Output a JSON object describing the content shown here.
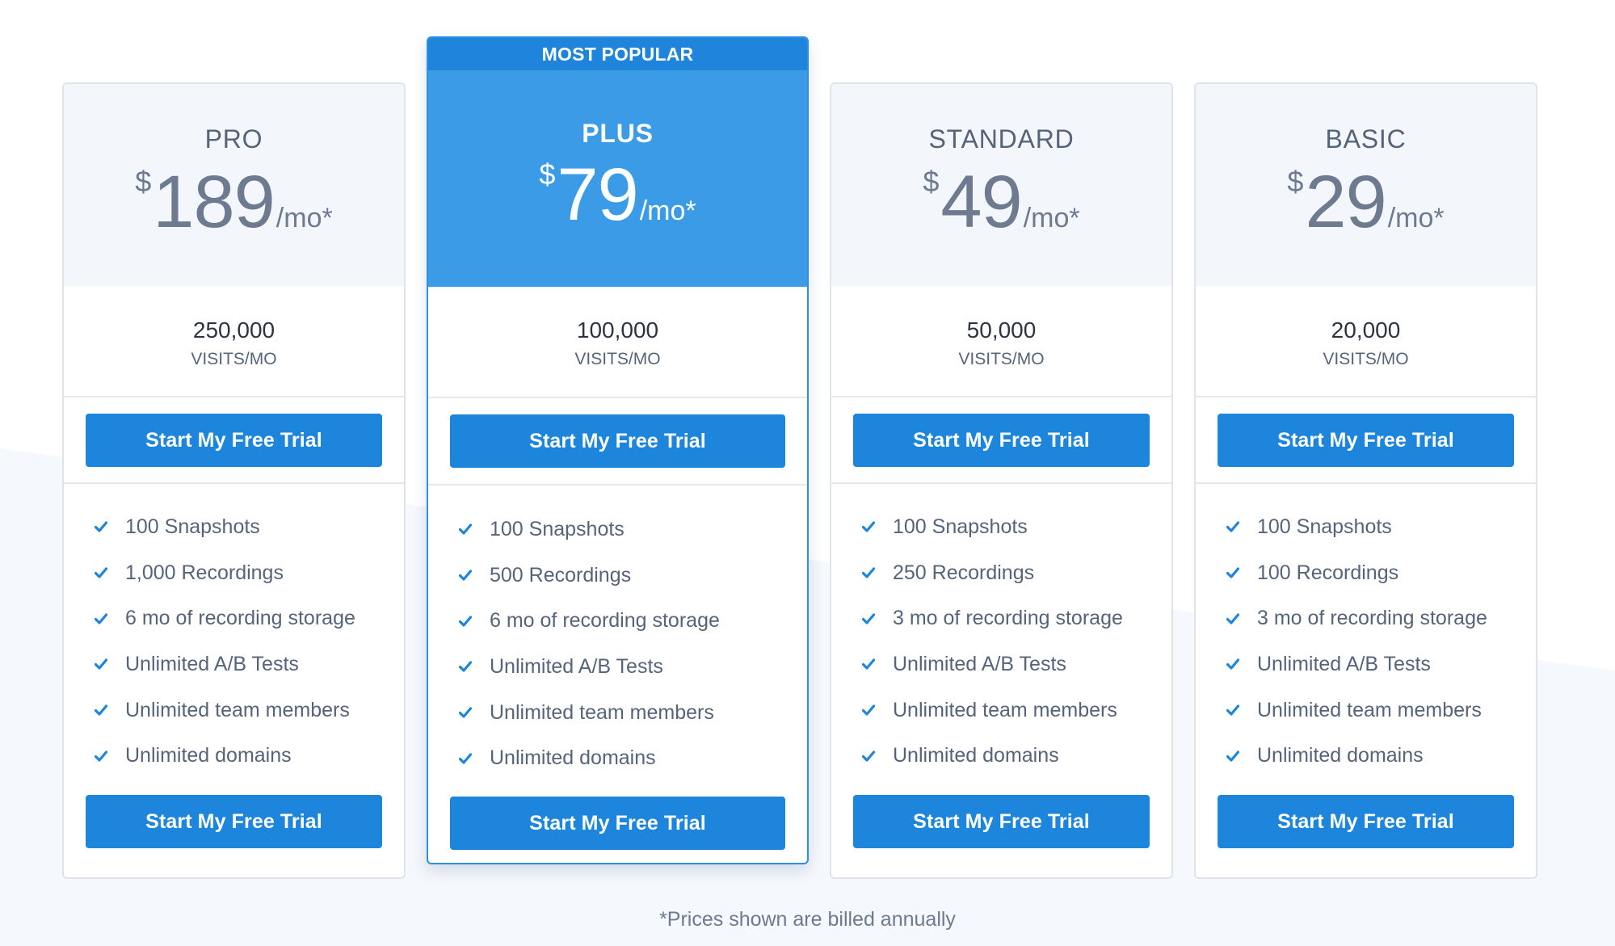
{
  "ribbon_label": "MOST POPULAR",
  "cta_label": "Start My Free Trial",
  "footnote": "*Prices shown are billed annually",
  "plans": [
    {
      "name": "PRO",
      "currency": "$",
      "price": "189",
      "period": "/mo*",
      "visits": "250,000",
      "visits_unit": "VISITS/MO",
      "features": [
        "100 Snapshots",
        "1,000 Recordings",
        "6 mo of recording storage",
        "Unlimited A/B Tests",
        "Unlimited team members",
        "Unlimited domains"
      ]
    },
    {
      "name": "PLUS",
      "currency": "$",
      "price": "79",
      "period": "/mo*",
      "visits": "100,000",
      "visits_unit": "VISITS/MO",
      "features": [
        "100 Snapshots",
        "500 Recordings",
        "6 mo of recording storage",
        "Unlimited A/B Tests",
        "Unlimited team members",
        "Unlimited domains"
      ]
    },
    {
      "name": "STANDARD",
      "currency": "$",
      "price": "49",
      "period": "/mo*",
      "visits": "50,000",
      "visits_unit": "VISITS/MO",
      "features": [
        "100 Snapshots",
        "250 Recordings",
        "3 mo of recording storage",
        "Unlimited A/B Tests",
        "Unlimited team members",
        "Unlimited domains"
      ]
    },
    {
      "name": "BASIC",
      "currency": "$",
      "price": "29",
      "period": "/mo*",
      "visits": "20,000",
      "visits_unit": "VISITS/MO",
      "features": [
        "100 Snapshots",
        "100 Recordings",
        "3 mo of recording storage",
        "Unlimited A/B Tests",
        "Unlimited team members",
        "Unlimited domains"
      ]
    }
  ],
  "colors": {
    "accent": "#1e85dc",
    "popular_header": "#3b9be6",
    "ribbon": "#1f84dc",
    "header_bg": "#f3f6fb",
    "text": "#56647a",
    "check": "#1e85dc"
  },
  "icons": {
    "feature_check": "checkmark-icon"
  }
}
